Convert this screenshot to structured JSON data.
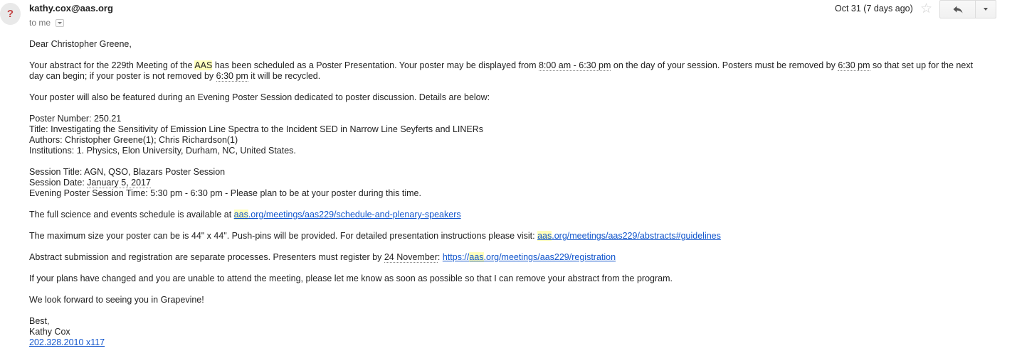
{
  "header": {
    "avatar_glyph": "?",
    "sender": "kathy.cox@aas.org",
    "recipient": "to me",
    "date": "Oct 31 (7 days ago)",
    "icons": [
      "question-mark-avatar",
      "dropdown-arrow-icon",
      "star-icon",
      "reply-icon",
      "more-options-icon"
    ]
  },
  "body": {
    "greeting": "Dear Christopher Greene,",
    "p1": {
      "a": "Your abstract for the 229th Meeting of the ",
      "aas": "AAS",
      "b": " has been scheduled as a Poster Presentation. Your poster may be displayed from ",
      "time_range": "8:00 am - 6:30 pm",
      "c": " on the day of your session. Posters must be removed by ",
      "time1": "6:30 pm",
      "d": " so that set up for the next day can begin; if your poster is not removed by ",
      "time2": "6:30 pm",
      "e": " it will be recycled."
    },
    "p2": "Your poster will also be featured during an Evening Poster Session dedicated to poster discussion. Details are below:",
    "poster": {
      "number": "Poster Number: 250.21",
      "title": "Title: Investigating the Sensitivity of Emission Line Spectra to the Incident SED in Narrow Line Seyferts and LINERs",
      "authors": "Authors: Christopher Greene(1); Chris Richardson(1)",
      "institutions": "Institutions: 1. Physics, Elon University, Durham, NC, United States."
    },
    "session": {
      "title": "Session Title: AGN, QSO, Blazars Poster Session",
      "date_label": "Session Date: ",
      "date_value": "January 5, 2017",
      "time": "Evening Poster Session Time: 5:30 pm - 6:30 pm - Please plan to be at your poster during this time."
    },
    "schedule": {
      "text": "The full science and events schedule is available at ",
      "link_hl": "aas",
      "link_rest": ".org/meetings/aas229/schedule-and-plenary-speakers"
    },
    "size": {
      "text": "The maximum size your poster can be is 44\" x 44\". Push-pins will be provided. For detailed presentation instructions please visit: ",
      "link_hl": "aas",
      "link_rest": ".org/meetings/aas229/abstracts#guidelines"
    },
    "registration": {
      "text_a": "Abstract submission and registration are separate processes. Presenters must register by ",
      "deadline": "24 November",
      "text_b": ": ",
      "link_pre": "https://",
      "link_hl": "aas",
      "link_rest": ".org/meetings/aas229/registration"
    },
    "plans": "If your plans have changed and you are unable to attend the meeting, please let me know as soon as possible so that I can remove your abstract from the program.",
    "closing": "We look forward to seeing you in Grapevine!",
    "signature": {
      "signoff": "Best,",
      "name": "Kathy Cox",
      "phone": "202.328.2010 x117"
    }
  },
  "colors": {
    "link": "#1155cc",
    "highlight": "#ffffbb",
    "avatar_glyph": "#c44343"
  }
}
